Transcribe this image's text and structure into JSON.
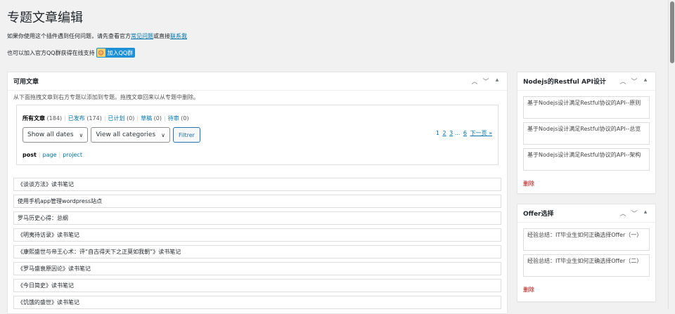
{
  "page": {
    "title": "专题文章编辑",
    "notice1_text": "如果你使用这个插件遇到任何问题，请先查看官方",
    "notice1_link1": "常见问题",
    "notice1_mid": "或直接",
    "notice1_link2": "联系我",
    "notice2_text": "也可以加入官方QQ群获得在线支持",
    "qq_button": "加入QQ群"
  },
  "available_panel": {
    "title": "可用文章",
    "hint": "从下面拖拽文章到右方专题以添加到专题。拖拽文章回来以从专题中删除。",
    "status_links": [
      {
        "label": "所有文章",
        "count": "(184)"
      },
      {
        "label": "已发布",
        "count": "(174)"
      },
      {
        "label": "已计划",
        "count": "(0)"
      },
      {
        "label": "草稿",
        "count": "(0)"
      },
      {
        "label": "待审",
        "count": "(0)"
      }
    ],
    "date_select": "Show all dates",
    "category_select": "View all categories",
    "filter_button": "Filtrer",
    "pagination": [
      "1",
      "2",
      "3",
      "...",
      "6",
      "下一页 »"
    ],
    "post_types": [
      "post",
      "page",
      "project"
    ],
    "articles": [
      "《谈谈方法》读书笔记",
      "使用手机app管理wordpress站点",
      "罗马历史心得：总纲",
      "《明夷待访录》读书笔记",
      "《康熙盛世与帝王心术：评“自古得天下之正莫如我朝”》读书笔记",
      "《罗马盛衰原因论》读书笔记",
      "《今日简史》读书笔记",
      "《饥饿的盛世》读书笔记"
    ]
  },
  "topic1": {
    "title": "Nodejs的Restful API设计",
    "items": [
      "基于Nodejs设计满足Restful协议的API--原则",
      "基于Nodejs设计满足Restful协议的API--总览",
      "基于Nodejs设计满足Restful协议的API--架构"
    ],
    "delete": "删除"
  },
  "topic2": {
    "title": "Offer选择",
    "items": [
      "经验总结：IT毕业生如何正确选择Offer（一）",
      "经验总结：IT毕业生如何正确选择Offer（二）"
    ],
    "delete": "删除"
  },
  "icons": {
    "collapse_up": "chevron-up-icon",
    "collapse_down": "chevron-down-icon",
    "toggle": "triangle-up-icon"
  },
  "colors": {
    "link": "#0073aa",
    "delete": "#aa0000",
    "qq_badge": "#1e90d6",
    "background": "#f1f1f1"
  }
}
